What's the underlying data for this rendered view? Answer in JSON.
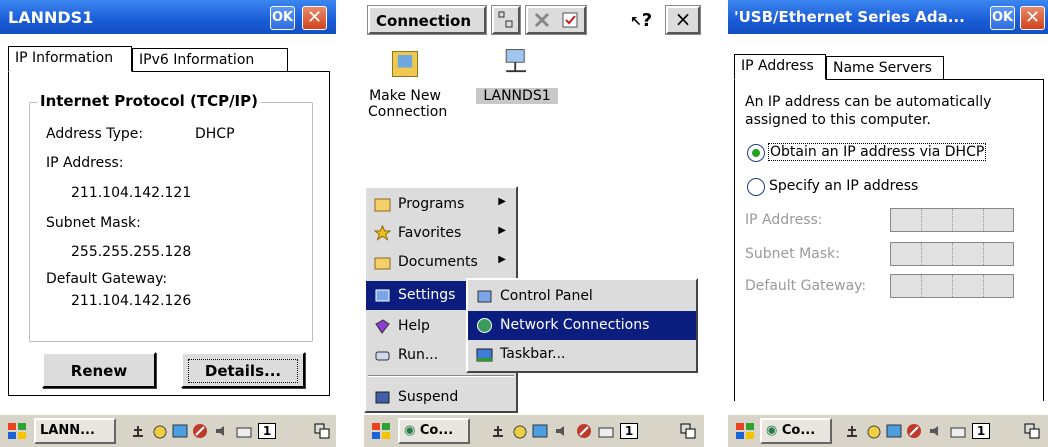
{
  "screen1": {
    "title": "LANNDS1",
    "ok_label": "OK",
    "close_glyph": "✕",
    "tabs": [
      "IP Information",
      "IPv6 Information"
    ],
    "group_title": "Internet Protocol (TCP/IP)",
    "address_type_label": "Address Type:",
    "address_type_value": "DHCP",
    "ip_label": "IP Address:",
    "ip_value": "211.104.142.121",
    "subnet_label": "Subnet Mask:",
    "subnet_value": "255.255.255.128",
    "gateway_label": "Default Gateway:",
    "gateway_value": "211.104.142.126",
    "renew_label": "Renew",
    "details_label": "Details...",
    "taskbar_button": "LANN..."
  },
  "screen2": {
    "title": "Connection",
    "help_glyph": "?",
    "close_glyph": "×",
    "items": [
      {
        "label": "Make New\nConnection"
      },
      {
        "label": "LANNDS1"
      }
    ],
    "start_menu": [
      "Programs",
      "Favorites",
      "Documents",
      "Settings",
      "Help",
      "Run...",
      "Suspend"
    ],
    "submenu": [
      "Control Panel",
      "Network Connections",
      "Taskbar..."
    ],
    "taskbar_button": "Co..."
  },
  "screen3": {
    "title": "'USB/Ethernet Series Ada...",
    "ok_label": "OK",
    "close_glyph": "✕",
    "tabs": [
      "IP Address",
      "Name Servers"
    ],
    "description_line1": "An IP address can be automatically",
    "description_line2": "assigned to this computer.",
    "radio_dhcp": "Obtain an IP address via DHCP",
    "radio_specify": "Specify an IP address",
    "ip_label": "IP Address:",
    "subnet_label": "Subnet Mask:",
    "gateway_label": "Default Gateway:",
    "taskbar_button": "Co..."
  },
  "tray_number": "1",
  "colors": {
    "titlebar": "#1a5cd6",
    "highlight": "#0c1d80",
    "radio_dot": "#1fa31f"
  }
}
